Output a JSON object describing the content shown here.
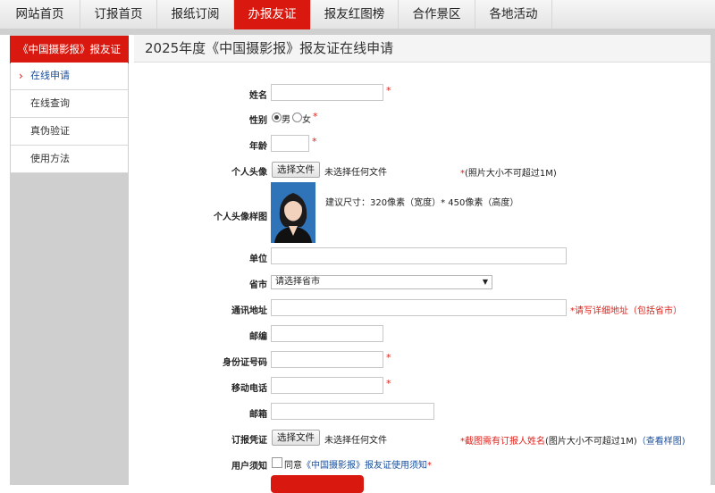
{
  "nav": {
    "items": [
      "网站首页",
      "订报首页",
      "报纸订阅",
      "办报友证",
      "报友红图榜",
      "合作景区",
      "各地活动"
    ],
    "active_index": 3
  },
  "sidebar": {
    "header": "《中国摄影报》报友证",
    "items": [
      "在线申请",
      "在线查询",
      "真伪验证",
      "使用方法"
    ],
    "active_index": 0
  },
  "main": {
    "title": "2025年度《中国摄影报》报友证在线申请"
  },
  "form": {
    "name_label": "姓名",
    "gender_label": "性别",
    "gender_male": "男",
    "gender_female": "女",
    "gender_selected": "男",
    "age_label": "年龄",
    "avatar_label": "个人头像",
    "file_button": "选择文件",
    "file_none": "未选择任何文件",
    "avatar_note": "(照片大小不可超过1M)",
    "sample_label": "个人头像样图",
    "sample_note": "建议尺寸：320像素（宽度）* 450像素（高度）",
    "unit_label": "单位",
    "province_label": "省市",
    "province_placeholder": "请选择省市",
    "address_label": "通讯地址",
    "address_note": "*请写详细地址（包括省市）",
    "postcode_label": "邮编",
    "idcard_label": "身份证号码",
    "mobile_label": "移动电话",
    "email_label": "邮箱",
    "voucher_label": "订报凭证",
    "voucher_note_red": "截图需有订报人姓名",
    "voucher_note_black": "(图片大小不可超过1M)",
    "voucher_note_link": "（查看样图)",
    "notice_label": "用户须知",
    "agree_text": "同意",
    "agree_link": "《中国摄影报》报友证使用须知",
    "required_mark": "*"
  },
  "colors": {
    "brand_red": "#d9190f",
    "link_blue": "#1a4f9c",
    "required_red": "#e0201a"
  }
}
